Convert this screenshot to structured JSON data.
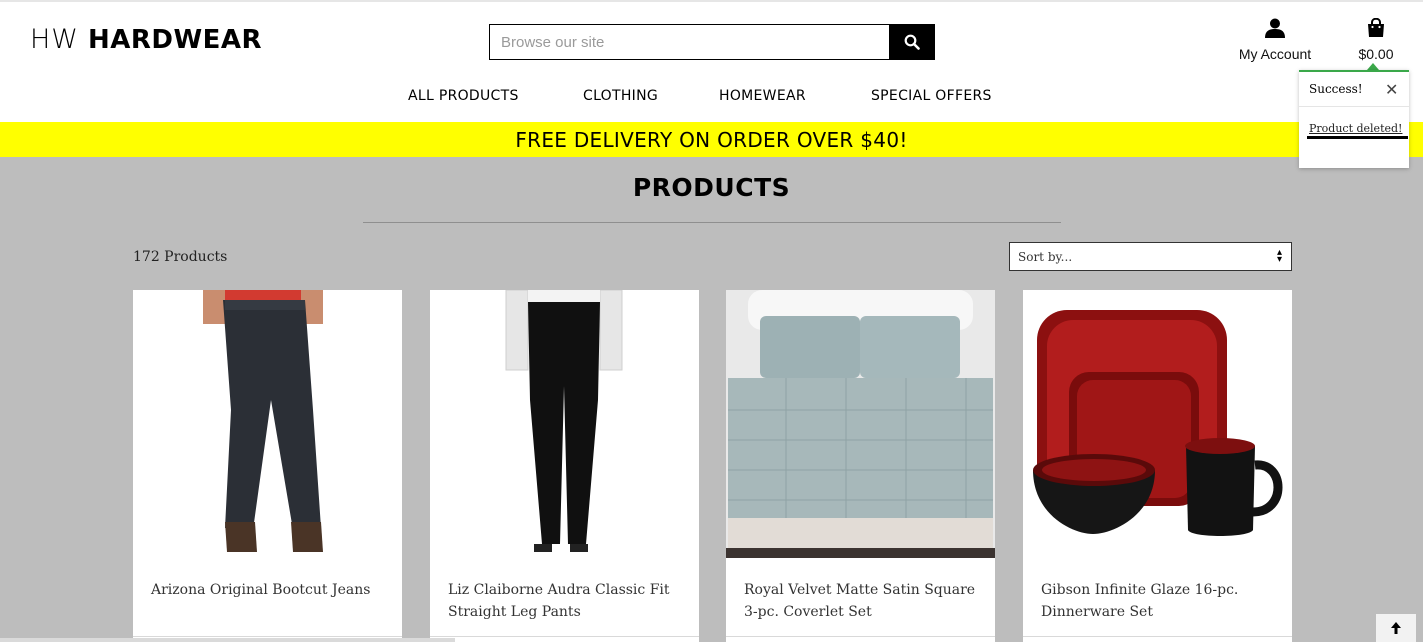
{
  "brand": {
    "prefix": "HW",
    "name": "HARDWEAR"
  },
  "search": {
    "placeholder": "Browse our site",
    "value": "",
    "icon": "search-icon"
  },
  "account": {
    "label": "My Account",
    "icon": "user-icon"
  },
  "cart": {
    "total": "$0.00",
    "icon": "shopping-bag-icon"
  },
  "nav": {
    "items": [
      "ALL PRODUCTS",
      "CLOTHING",
      "HOMEWEAR",
      "SPECIAL OFFERS"
    ]
  },
  "banner": {
    "text": "FREE DELIVERY ON ORDER OVER $40!",
    "color": "#ffff00"
  },
  "page": {
    "title": "PRODUCTS",
    "count": "172 Products"
  },
  "sort": {
    "selected": "Sort by..."
  },
  "products": [
    {
      "name": "Arizona Original Bootcut Jeans",
      "image": "jeans"
    },
    {
      "name": "Liz Claiborne Audra Classic Fit Straight Leg Pants",
      "image": "black-pants"
    },
    {
      "name": "Royal Velvet Matte Satin Square 3-pc. Coverlet Set",
      "image": "bed-coverlet"
    },
    {
      "name": "Gibson Infinite Glaze 16-pc. Dinnerware Set",
      "image": "red-dinnerware"
    }
  ],
  "toast": {
    "title": "Success!",
    "message": "Product deleted!",
    "close": "✕",
    "accent": "#3aa84a"
  },
  "back_to_top": {
    "icon": "arrow-up-icon"
  }
}
